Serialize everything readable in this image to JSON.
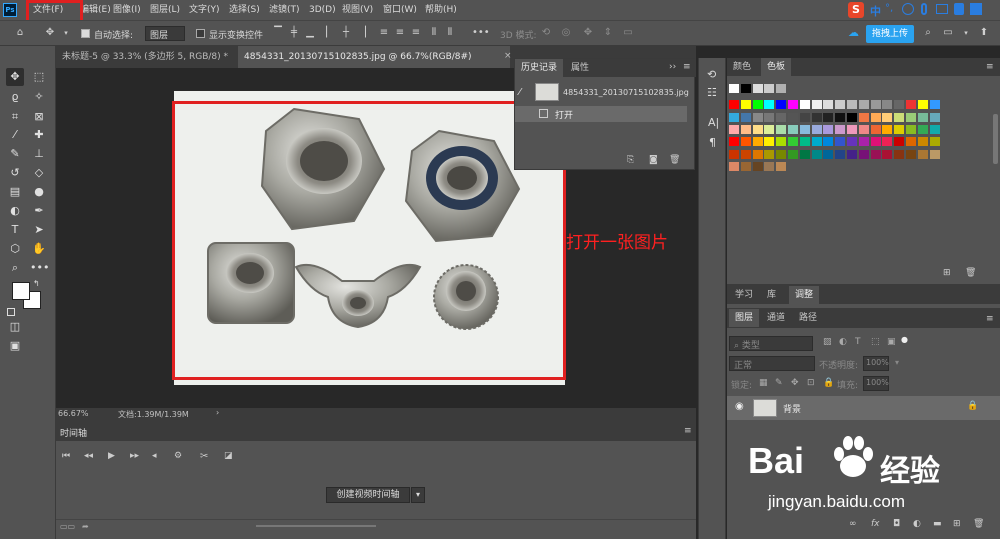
{
  "menubar": {
    "logo": "Ps",
    "items": [
      "文件(F)",
      "编辑(E)",
      "图像(I)",
      "图层(L)",
      "文字(Y)",
      "选择(S)",
      "滤镜(T)",
      "3D(D)",
      "视图(V)",
      "窗口(W)",
      "帮助(H)"
    ],
    "ime_label": "中",
    "ime_extra": "°,"
  },
  "optionsbar": {
    "auto_select_label": "自动选择:",
    "auto_select_value": "图层",
    "show_transform_label": "显示变换控件",
    "mode_3d_label": "3D 模式:",
    "upload_button": "拖拽上传"
  },
  "doc_tabs": [
    {
      "label": "未标题-5 @ 33.3% (多边形 5, RGB/8) *",
      "active": false
    },
    {
      "label": "4854331_20130715102835.jpg @ 66.7%(RGB/8#)",
      "active": true
    }
  ],
  "canvas": {
    "annotation": "打开一张图片"
  },
  "statusbar": {
    "zoom": "66.67%",
    "doc_info": "文档:1.39M/1.39M"
  },
  "history_panel": {
    "tabs": [
      "历史记录",
      "属性"
    ],
    "snapshot_name": "4854331_20130715102835.jpg",
    "steps": [
      "打开"
    ]
  },
  "timeline_panel": {
    "title": "时间轴",
    "create_button": "创建视频时间轴"
  },
  "swatches_panel": {
    "tabs": [
      "颜色",
      "色板"
    ],
    "rows": [
      [
        "#ffffff",
        "#000000",
        "#dddddd",
        "#cccccc",
        "#b0b0b0"
      ],
      [
        "#ff0000",
        "#ffff00",
        "#00ff00",
        "#00ffff",
        "#0000ff",
        "#ff00ff",
        "#ffffff",
        "#eeeeee",
        "#dddddd",
        "#cccccc",
        "#bbbbbb",
        "#aaaaaa",
        "#999999",
        "#888888",
        "#666666",
        "#ee3333",
        "#ffff00",
        "#3399ff"
      ],
      [
        "#33aadd",
        "#4477aa",
        "#888888",
        "#777777",
        "#666666",
        "#555555",
        "#444444",
        "#333333",
        "#222222",
        "#111111",
        "#000000",
        "#ee7744",
        "#ffaa55",
        "#ffcc77",
        "#ccdd77",
        "#99cc77",
        "#77bb99",
        "#66aabb"
      ],
      [
        "#ffaaaa",
        "#ffbb88",
        "#ffdd88",
        "#ddee99",
        "#aaddaa",
        "#88ccbb",
        "#88bbdd",
        "#99aadd",
        "#aa99dd",
        "#cc99cc",
        "#ee99bb",
        "#ee8888",
        "#ee6633",
        "#ffaa00",
        "#ddcc00",
        "#88bb22",
        "#33aa55",
        "#11aaaa"
      ],
      [
        "#ff0000",
        "#ff5500",
        "#ffaa00",
        "#ffee00",
        "#aadd00",
        "#33cc33",
        "#00bb88",
        "#00aacc",
        "#0088dd",
        "#3355cc",
        "#6633bb",
        "#aa22aa",
        "#dd1177",
        "#ee2255",
        "#cc0000",
        "#dd6600",
        "#cc8800",
        "#aaaa00"
      ],
      [
        "#cc3300",
        "#cc4400",
        "#dd7700",
        "#aa9900",
        "#778800",
        "#339922",
        "#007744",
        "#008888",
        "#006699",
        "#224488",
        "#442288",
        "#771177",
        "#991155",
        "#aa1133",
        "#883311",
        "#774411",
        "#aa7733",
        "#bb9966"
      ],
      [
        "#dd8866",
        "#996633",
        "#664422",
        "#997755",
        "#bb8855"
      ]
    ]
  },
  "learn_panel": {
    "tabs": [
      "学习",
      "库",
      "调整"
    ]
  },
  "layers_panel": {
    "tabs": [
      "图层",
      "通道",
      "路径"
    ],
    "filter_label": "类型",
    "blend_mode": "正常",
    "opacity_label": "不透明度:",
    "opacity_value": "100%",
    "lock_label": "锁定:",
    "fill_label": "填充:",
    "fill_value": "100%",
    "layers": [
      {
        "name": "背景"
      }
    ]
  },
  "watermark": {
    "brand_left": "Bai",
    "brand_right": "经验",
    "url": "jingyan.baidu.com"
  },
  "colors": {
    "annotation_red": "#ff2020",
    "ui_dark": "#282828",
    "ui_panel": "#535353",
    "accent_blue": "#2aa3f0"
  }
}
